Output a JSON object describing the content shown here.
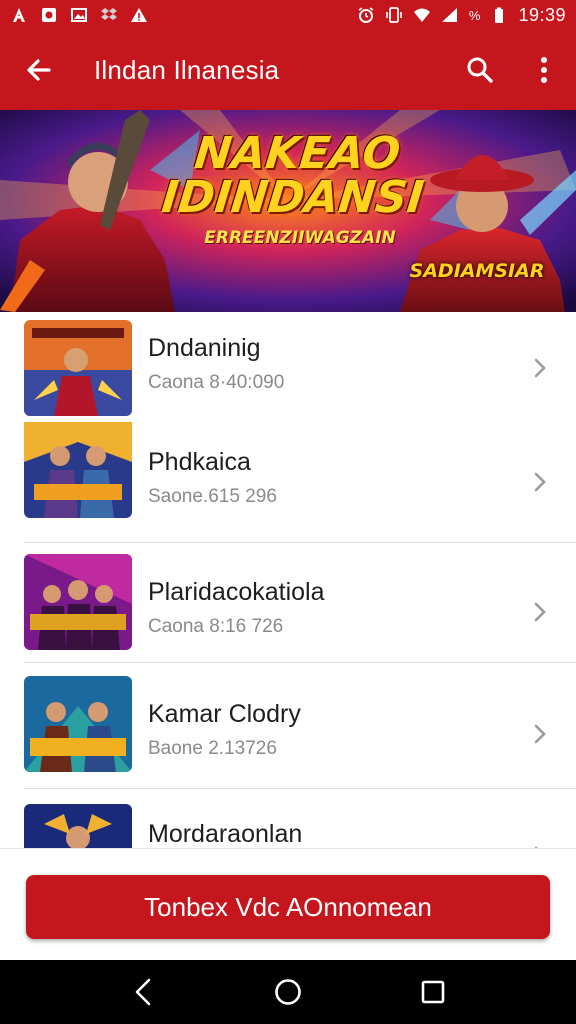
{
  "status_bar": {
    "battery_percent": "%",
    "time": "19:39"
  },
  "app_bar": {
    "title": "Ilndan Ilnanesia"
  },
  "banner": {
    "title": "NAKEAO IDINDANSI",
    "subtitle": "ERREENZIIWAGZAIN",
    "tag": "SADIAMSIAR"
  },
  "list": {
    "items": [
      {
        "name": "Dndaninig",
        "subtitle": "Caona 8·40:090"
      },
      {
        "name": "Phdkaica",
        "subtitle": "Saone.615 296"
      },
      {
        "name": "Plaridacokatiola",
        "subtitle": "Caona 8:16 726"
      },
      {
        "name": "Kamar Clodry",
        "subtitle": "Baone 2.13726"
      },
      {
        "name": "Mordaraonlan",
        "subtitle": ""
      }
    ]
  },
  "bottom": {
    "cta_label": "Tonbex Vdc AOnnomean"
  },
  "colors": {
    "primary": "#c4161c",
    "text": "#1e1e1e",
    "secondary_text": "#8a8a8a"
  },
  "icons": {
    "back": "arrow-left-icon",
    "search": "search-icon",
    "more": "more-vert-icon",
    "chevron": "chevron-right-icon"
  }
}
